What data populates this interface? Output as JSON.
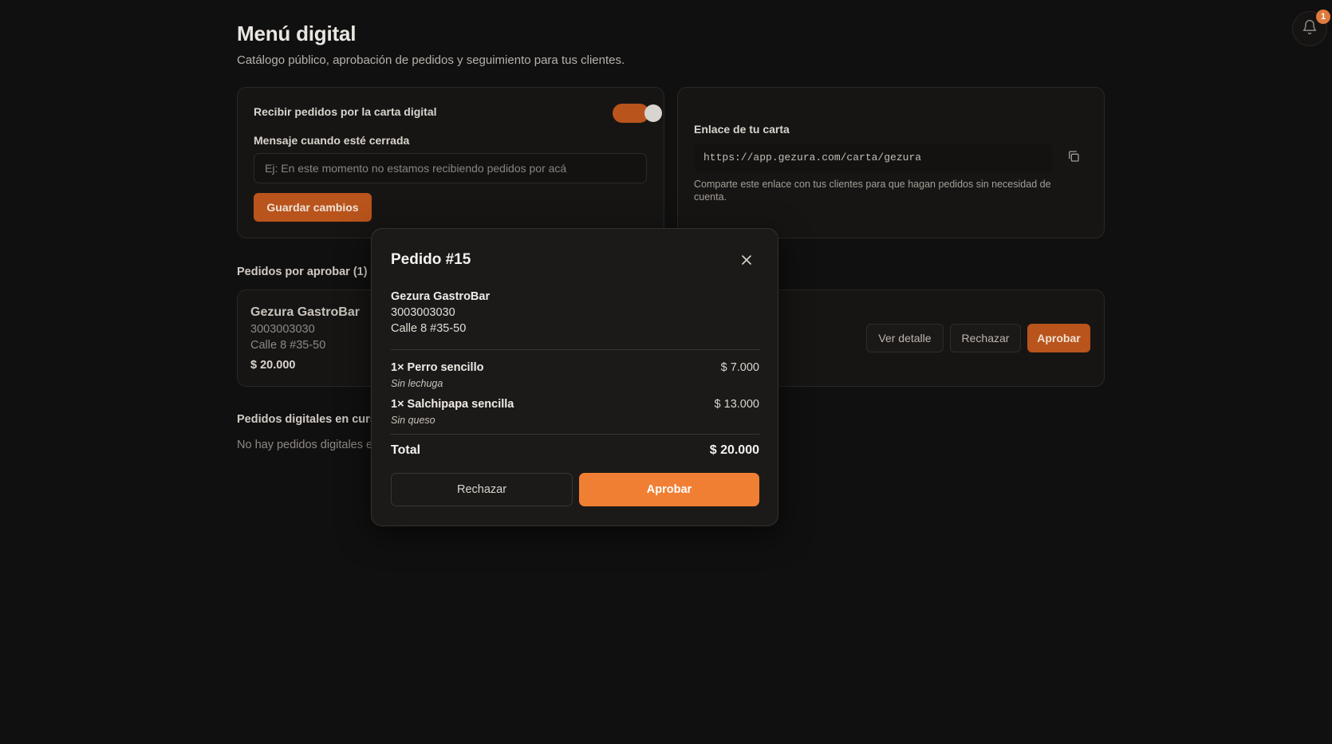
{
  "header": {
    "title": "Menú digital",
    "subtitle": "Catálogo público, aprobación de pedidos y seguimiento para tus clientes."
  },
  "notifications": {
    "count": "1",
    "icon": "bell-icon",
    "badge_color": "#e07a3c"
  },
  "settings": {
    "receive_label": "Recibir pedidos por la carta digital",
    "receive_enabled": true,
    "closed_message_label": "Mensaje cuando esté cerrada",
    "closed_message_value": "",
    "closed_message_placeholder": "Ej: En este momento no estamos recibiendo pedidos por acá",
    "save_label": "Guardar cambios"
  },
  "link_card": {
    "title": "Enlace de tu carta",
    "url": "https://app.gezura.com/carta/gezura",
    "copy_icon": "copy-icon",
    "help": "Comparte este enlace con tus clientes para que hagan pedidos sin necesidad de cuenta."
  },
  "pending": {
    "title": "Pedidos por aprobar (1)",
    "orders": [
      {
        "customer": "Gezura GastroBar",
        "phone": "3003003030",
        "address": "Calle 8 #35-50",
        "total": "$ 20.000",
        "detail_label": "Ver detalle",
        "reject_label": "Rechazar",
        "approve_label": "Aprobar"
      }
    ]
  },
  "in_progress": {
    "title": "Pedidos digitales en curs",
    "empty": "No hay pedidos digitales e"
  },
  "modal": {
    "title": "Pedido #15",
    "close_icon": "close-icon",
    "customer": "Gezura GastroBar",
    "phone": "3003003030",
    "address": "Calle 8 #35-50",
    "items": [
      {
        "name": "1× Perro sencillo",
        "note": "Sin lechuga",
        "price": "$ 7.000"
      },
      {
        "name": "1× Salchipapa sencilla",
        "note": "Sin queso",
        "price": "$ 13.000"
      }
    ],
    "total_label": "Total",
    "total_value": "$ 20.000",
    "reject_label": "Rechazar",
    "approve_label": "Aprobar"
  },
  "colors": {
    "background": "#111010",
    "accent": "#f07f33",
    "accent_muted": "#b8541c"
  }
}
